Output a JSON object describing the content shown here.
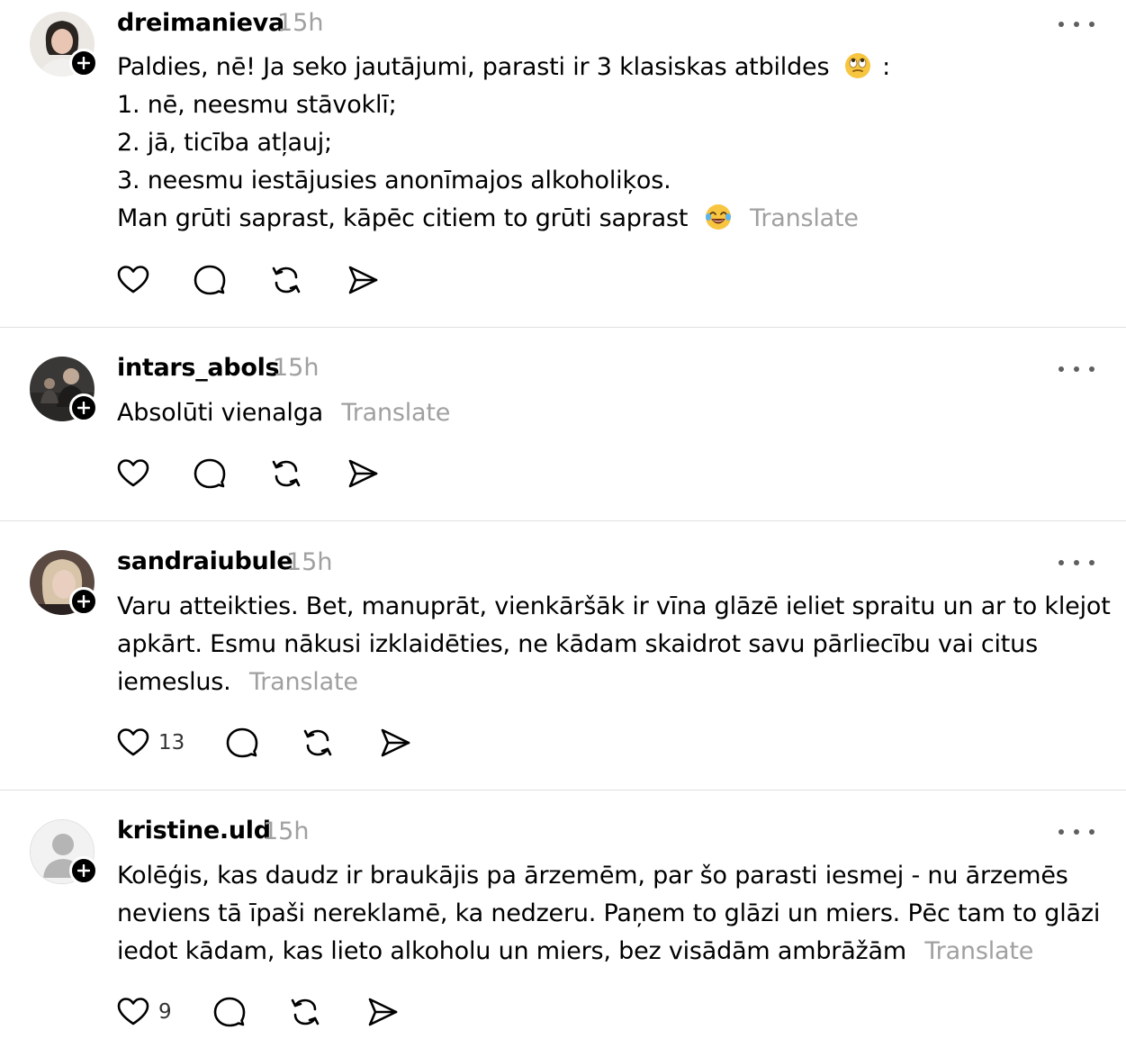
{
  "posts": [
    {
      "username": "dreimanieva",
      "time": "15h",
      "lines": [
        "Paldies, nē! Ja seko jautājumi, parasti ir 3 klasiskas atbildes",
        "1. nē, neesmu stāvoklī;",
        "2. jā, ticība atļauj;",
        "3. neesmu iestājusies anonīmajos alkoholiķos.",
        "Man grūti saprast, kāpēc citiem to grūti saprast"
      ],
      "line1_suffix": ":",
      "emoji1": "eye-roll-emoji",
      "emoji2": "tears-of-joy-emoji",
      "translate": "Translate",
      "likes": ""
    },
    {
      "username": "intars_abols",
      "time": "15h",
      "lines": [
        "Absolūti vienalga"
      ],
      "translate": "Translate",
      "likes": ""
    },
    {
      "username": "sandraiubule",
      "time": "15h",
      "lines": [
        "Varu atteikties. Bet, manuprāt, vienkāršāk ir vīna glāzē ieliet spraitu un ar to klejot",
        "apkārt. Esmu nākusi izklaidēties, ne kādam skaidrot savu pārliecību vai citus",
        "iemeslus."
      ],
      "translate": "Translate",
      "likes": "13"
    },
    {
      "username": "kristine.uld",
      "time": "15h",
      "lines": [
        "Kolēģis, kas daudz ir braukājis pa ārzemēm, par šo parasti iesmej - nu ārzemēs",
        "neviens tā īpaši nereklamē, ka nedzeru. Paņem to glāzi un miers. Pēc tam to glāzi",
        "iedot kādam, kas lieto alkoholu un miers, bez visādām ambrāžām"
      ],
      "translate": "Translate",
      "likes": "9"
    }
  ],
  "icons": {
    "like": "heart-icon",
    "reply": "comment-icon",
    "repost": "repost-icon",
    "share": "send-icon",
    "more": "more-dots-icon",
    "follow": "plus-icon"
  },
  "colors": {
    "text": "#000000",
    "muted": "#a0a0a0",
    "divider": "#e0e0e0"
  }
}
